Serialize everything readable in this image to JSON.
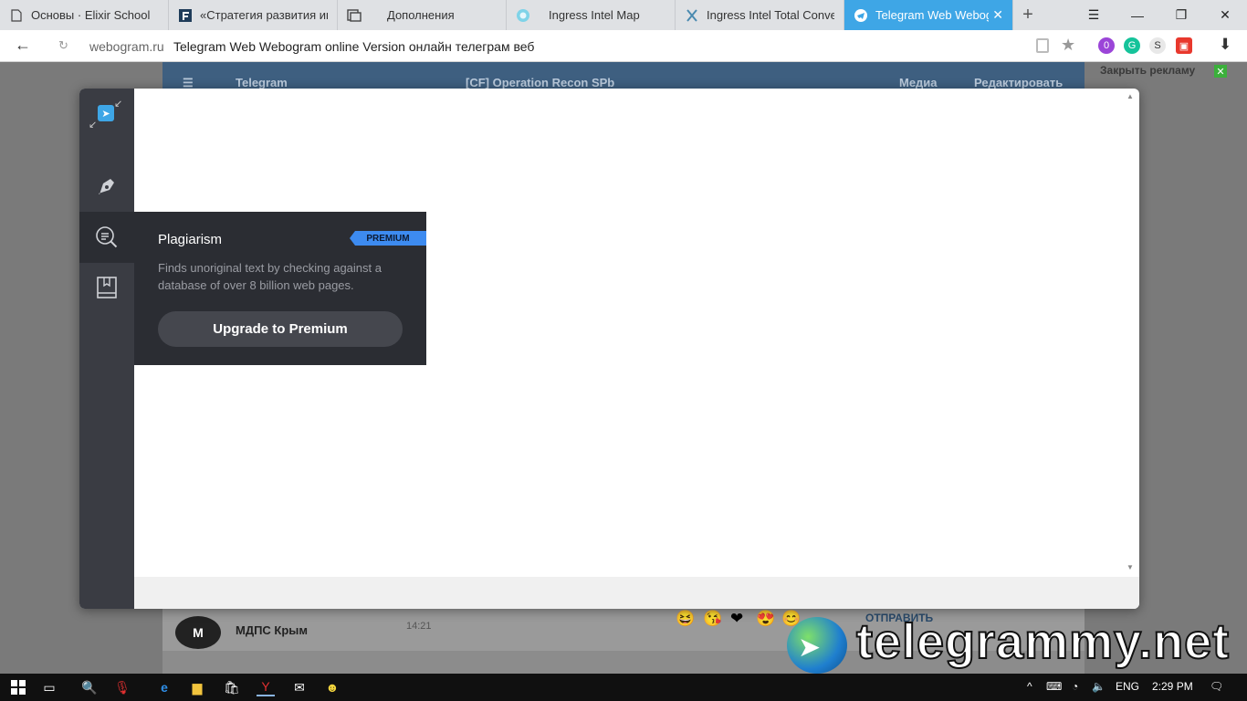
{
  "browser": {
    "tabs": [
      {
        "label": "Основы · Elixir School",
        "icon": "document-icon",
        "active": false
      },
      {
        "label": "«Стратегия развития инс",
        "icon": "f-logo-icon",
        "active": false
      },
      {
        "label": "Дополнения",
        "icon": "extensions-icon",
        "active": false
      },
      {
        "label": "Ingress Intel Map",
        "icon": "ingress-icon",
        "active": false
      },
      {
        "label": "Ingress Intel Total Convers",
        "icon": "ingress-icon",
        "active": false
      },
      {
        "label": "Telegram Web Webogr",
        "icon": "telegram-icon",
        "active": true
      }
    ],
    "address": {
      "domain": "webogram.ru",
      "title": "Telegram Web Webogram online Version онлайн телеграм веб"
    },
    "extension_badge": "0"
  },
  "background_page": {
    "header": {
      "app_name": "Telegram",
      "chat_title": "[CF] Operation Recon SPb",
      "media": "Медиа",
      "edit": "Редактировать"
    },
    "ad_close": "Закрыть рекламу",
    "chat_item": {
      "name": "МДПС Крым",
      "time": "14:21"
    },
    "send_button": "ОТПРАВИТЬ"
  },
  "grammarly": {
    "popup": {
      "title": "Plagiarism",
      "badge": "PREMIUM",
      "description": "Finds unoriginal text by checking against a database of over 8 billion web pages.",
      "button": "Upgrade to Premium"
    }
  },
  "watermark": {
    "text": "telegrammy.net"
  },
  "taskbar": {
    "language": "ENG",
    "time": "2:29 PM"
  }
}
